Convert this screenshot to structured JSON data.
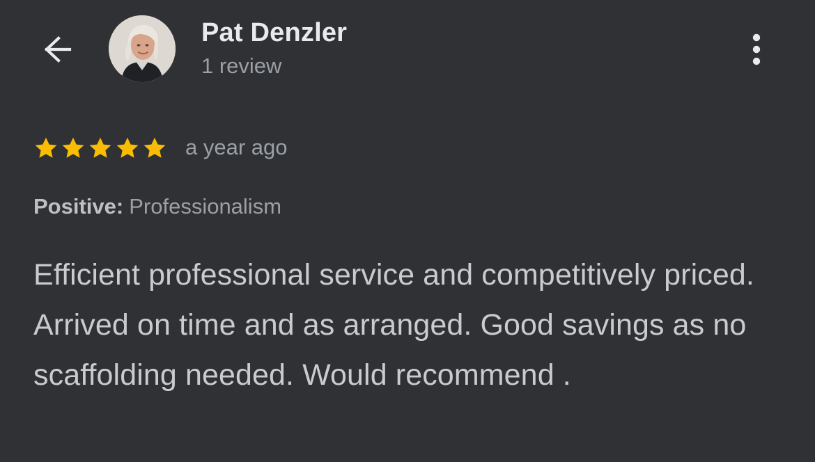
{
  "header": {
    "user_name": "Pat Denzler",
    "review_count": "1 review",
    "back_icon": "arrow-left-icon",
    "more_icon": "more-vertical-icon",
    "avatar_icon": "user-avatar"
  },
  "review": {
    "rating": 5,
    "max_rating": 5,
    "star_color": "#FBBC04",
    "time_ago": "a year ago",
    "attribute_label": "Positive:",
    "attribute_value": "Professionalism",
    "text": "Efficient professional service and competitively priced. Arrived on time and as arranged. Good savings as no scaffolding needed. Would recommend ."
  },
  "theme": {
    "background": "#303134",
    "primary_text": "#E8EAED",
    "secondary_text": "#9AA0A6"
  }
}
